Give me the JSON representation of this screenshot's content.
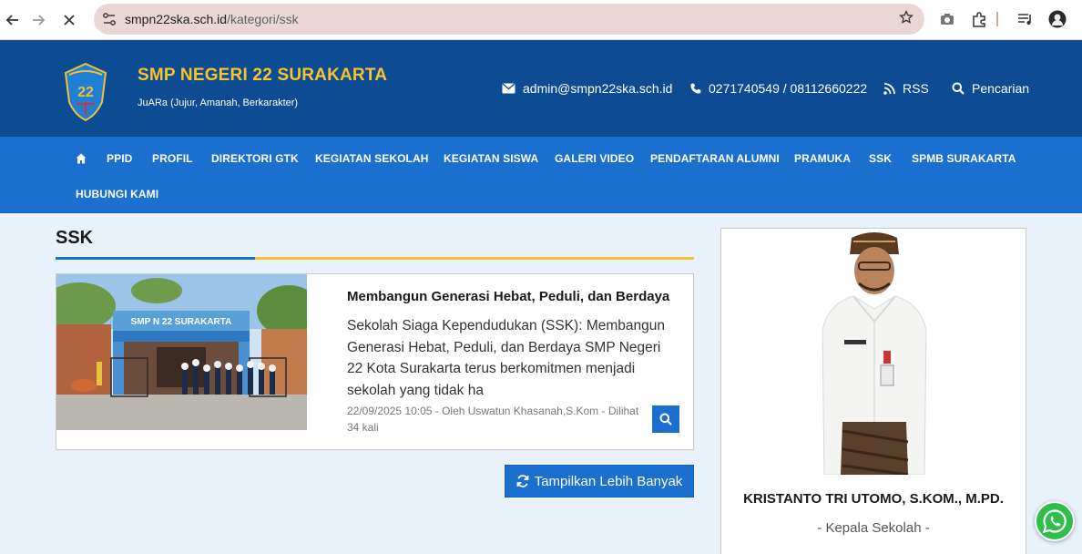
{
  "browser": {
    "url_domain": "smpn22ska.sch.id",
    "url_path": "/kategori/ssk"
  },
  "site": {
    "name": "SMP NEGERI 22 SURAKARTA",
    "tagline": "JuARa (Jujur, Amanah, Berkarakter)",
    "email": "admin@smpn22ska.sch.id",
    "phone": "0271740549 / 08112660222",
    "rss_label": "RSS",
    "search_label": "Pencarian"
  },
  "nav": {
    "items": [
      "PPID",
      "PROFIL",
      "DIREKTORI GTK",
      "KEGIATAN SEKOLAH",
      "KEGIATAN SISWA",
      "GALERI VIDEO",
      "PENDAFTARAN ALUMNI",
      "PRAMUKA",
      "SSK",
      "SPMB SURAKARTA",
      "HUBUNGI KAMI"
    ]
  },
  "main": {
    "section_title": "SSK",
    "post": {
      "image_sign": "SMP N 22 SURAKARTA",
      "title": "Membangun Generasi Hebat, Peduli, dan Berdaya",
      "excerpt": "Sekolah Siaga Kependudukan (SSK): Membangun Generasi Hebat, Peduli, dan Berdaya   SMP Negeri 22 Kota Surakarta terus berkomitmen menjadi sekolah yang tidak ha",
      "meta": "22/09/2025 10:05 - Oleh Uswatun Khasanah,S.Kom - Dilihat 34 kali"
    },
    "more_button": "Tampilkan Lebih Banyak"
  },
  "sidebar": {
    "head_name": "KRISTANTO TRI UTOMO, S.KOM., M.PD.",
    "head_role": "- Kepala Sekolah -"
  },
  "colors": {
    "header_bg": "#0d4b93",
    "nav_bg": "#1a6fcf",
    "accent_gold": "#f2c12e",
    "whatsapp": "#2fbd4b"
  },
  "icons": [
    "back-arrow-icon",
    "forward-arrow-icon",
    "stop-icon",
    "site-settings-icon",
    "bookmark-star-icon",
    "camera-icon",
    "extensions-icon",
    "media-queue-icon",
    "profile-avatar-icon",
    "envelope-icon",
    "phone-icon",
    "rss-icon",
    "search-icon",
    "home-icon",
    "refresh-icon",
    "whatsapp-icon"
  ]
}
